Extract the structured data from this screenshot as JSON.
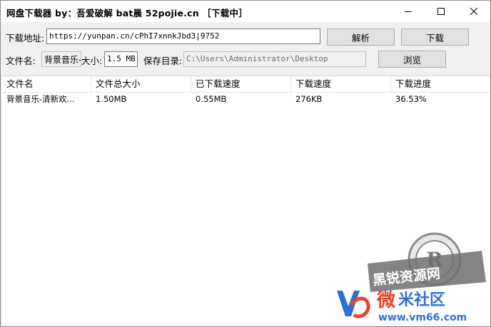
{
  "window": {
    "title": "网盘下载器 by：吾爱破解 bat晨 52pojie.cn ［下载中］"
  },
  "form": {
    "url_label": "下载地址:",
    "url_value": "https://yunpan.cn/cPhI7xnnkJbd3|9752",
    "parse_button": "解析",
    "download_button": "下载",
    "filename_label": "文件名:",
    "filename_value": "背景音乐-",
    "size_label": "大小:",
    "size_value": "1.5 MB",
    "save_dir_label": "保存目录:",
    "save_dir_value": "C:\\Users\\Administrator\\Desktop",
    "browse_button": "浏览"
  },
  "table": {
    "columns": [
      "文件名",
      "文件总大小",
      "已下载速度",
      "下载速度",
      "下载进度"
    ],
    "rows": [
      {
        "name": "背景音乐-清新欢...",
        "total": "1.50MB",
        "downloaded": "0.55MB",
        "speed": "276KB",
        "progress": "36.53%"
      }
    ]
  },
  "watermark": {
    "seal_text": "黑锐资源网",
    "brand_cn": "微",
    "brand_cn_rest": "米社区",
    "brand_url": "www.vm66.com"
  },
  "colors": {
    "brand_red": "#e8432c",
    "brand_blue": "#2f6fd1"
  }
}
